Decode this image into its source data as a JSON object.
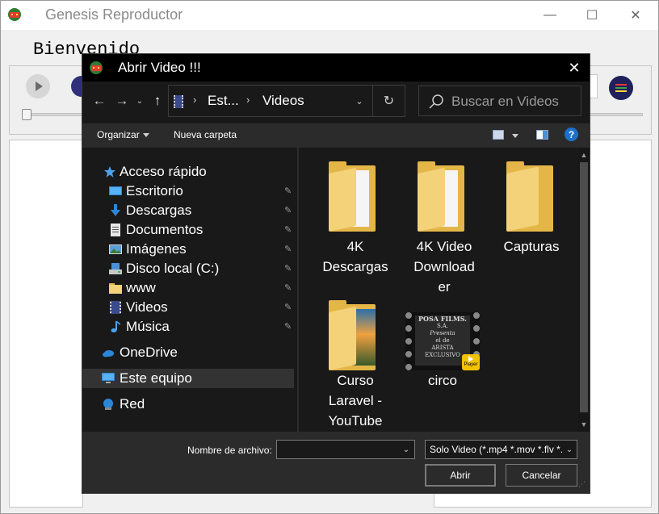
{
  "app": {
    "title": "Genesis Reproductor",
    "welcome": "Bienvenido",
    "controls": {
      "minimize_glyph": "—",
      "maximize_glyph": "☐",
      "close_glyph": "✕"
    }
  },
  "dialog": {
    "title": "Abrir Video !!!",
    "close_glyph": "✕",
    "nav": {
      "back_glyph": "←",
      "forward_glyph": "→",
      "recent_glyph": "⌄",
      "up_glyph": "↑"
    },
    "address": {
      "separator": "›",
      "segment_1": "Est...",
      "segment_2": "Videos",
      "dropdown_glyph": "⌄",
      "refresh_glyph": "↻"
    },
    "search": {
      "placeholder": "Buscar en Videos"
    },
    "toolbar": {
      "organizar": "Organizar",
      "nueva_carpeta": "Nueva carpeta",
      "help": "?"
    },
    "nav_pane": {
      "items": [
        {
          "label": "Acceso rápido",
          "icon": "star-icon",
          "pinned": false
        },
        {
          "label": "Escritorio",
          "icon": "desktop-icon",
          "pinned": true
        },
        {
          "label": "Descargas",
          "icon": "download-icon",
          "pinned": true
        },
        {
          "label": "Documentos",
          "icon": "document-icon",
          "pinned": true
        },
        {
          "label": "Imágenes",
          "icon": "image-icon",
          "pinned": true
        },
        {
          "label": "Disco local (C:)",
          "icon": "drive-icon",
          "pinned": true
        },
        {
          "label": "www",
          "icon": "folder-icon",
          "pinned": true
        },
        {
          "label": "Videos",
          "icon": "video-icon",
          "pinned": true
        },
        {
          "label": "Música",
          "icon": "music-icon",
          "pinned": true
        },
        {
          "label": "OneDrive",
          "icon": "cloud-icon",
          "pinned": false
        },
        {
          "label": "Este equipo",
          "icon": "computer-icon",
          "pinned": false,
          "selected": true
        },
        {
          "label": "Red",
          "icon": "network-icon",
          "pinned": false
        }
      ],
      "pin_glyph": "📌"
    },
    "files": [
      {
        "name_lines": [
          "4K",
          "Descargas"
        ],
        "type": "folder"
      },
      {
        "name_lines": [
          "4K Video",
          "Download",
          "er"
        ],
        "type": "folder"
      },
      {
        "name_lines": [
          "Capturas"
        ],
        "type": "folder"
      },
      {
        "name_lines": [
          "Curso",
          "Laravel -",
          "YouTube"
        ],
        "type": "folder"
      },
      {
        "name_lines": [
          "circo"
        ],
        "type": "video",
        "thumb_text": [
          "POSA FILMS.",
          "S.A.",
          "Presenta",
          "el de",
          "ARISTA EXCLUSIVO"
        ],
        "badge": "Player"
      }
    ],
    "scrollbar": {
      "up_glyph": "▲",
      "down_glyph": "▼"
    },
    "bottom": {
      "filename_label": "Nombre de archivo:",
      "filename_value": "",
      "filename_caret": "⌄",
      "filter_value": "Solo Video (*.mp4 *.mov *.flv *.",
      "filter_caret": "⌄",
      "open": "Abrir",
      "cancel": "Cancelar",
      "grip": "⋰"
    }
  },
  "colors": {
    "dialog_bg": "#191919",
    "toolbar_bg": "#2b2b2b",
    "folder": "#e4b648",
    "accent_blue": "#1c70c8"
  }
}
